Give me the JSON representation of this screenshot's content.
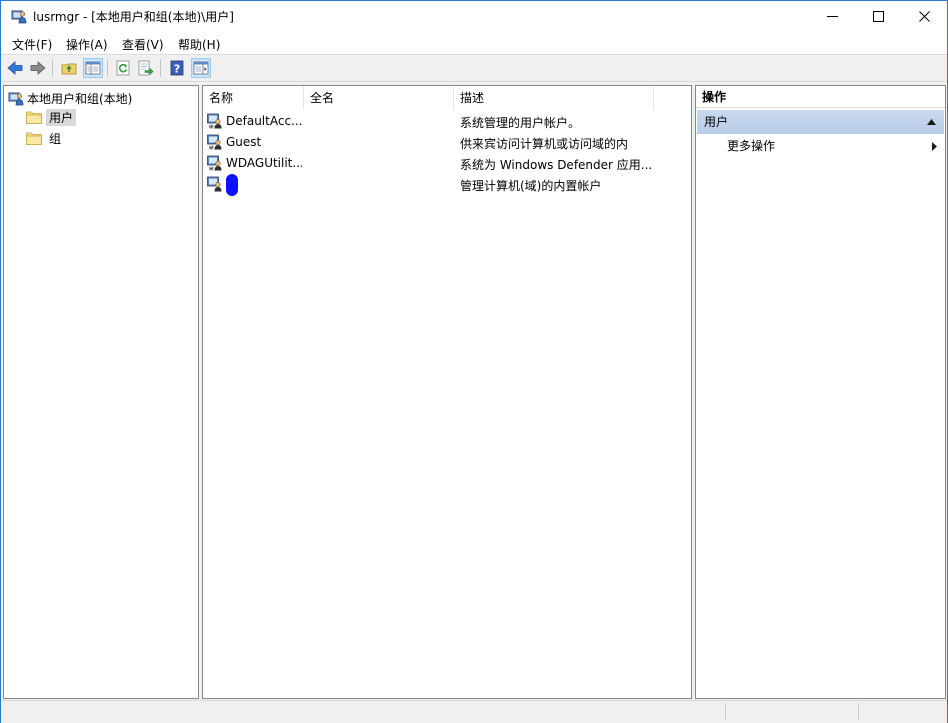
{
  "window": {
    "title": "lusrmgr - [本地用户和组(本地)\\用户]",
    "icons": {
      "app": "users-computer-icon",
      "minimize": "minimize-icon",
      "maximize": "maximize-icon",
      "close": "close-icon"
    }
  },
  "menu": [
    "文件(F)",
    "操作(A)",
    "查看(V)",
    "帮助(H)"
  ],
  "toolbar": {
    "buttons": [
      "back-arrow-icon",
      "forward-arrow-icon",
      "up-folder-icon",
      "show-tree-icon",
      "refresh-icon",
      "export-list-icon",
      "help-icon",
      "show-action-pane-icon"
    ]
  },
  "tree": {
    "root": "本地用户和组(本地)",
    "children": [
      {
        "label": "用户",
        "selected": true
      },
      {
        "label": "组",
        "selected": false
      }
    ]
  },
  "list": {
    "columns": [
      "名称",
      "全名",
      "描述"
    ],
    "rows": [
      {
        "name": "DefaultAcc...",
        "fullname": "",
        "description": "系统管理的用户帐户。"
      },
      {
        "name": "Guest",
        "fullname": "",
        "description": "供来宾访问计算机或访问域的内"
      },
      {
        "name": "WDAGUtilit...",
        "fullname": "",
        "description": "系统为 Windows Defender 应用..."
      },
      {
        "name": "",
        "fullname": "",
        "description": "管理计算机(域)的内置帐户",
        "redacted": true
      }
    ]
  },
  "actions": {
    "header": "操作",
    "section": "用户",
    "items": [
      "更多操作"
    ]
  },
  "colors": {
    "accent_border": "#2b79d6",
    "selection": "#d9d9d9",
    "action_section": "#c4d6ee",
    "redaction": "#1010ff"
  }
}
